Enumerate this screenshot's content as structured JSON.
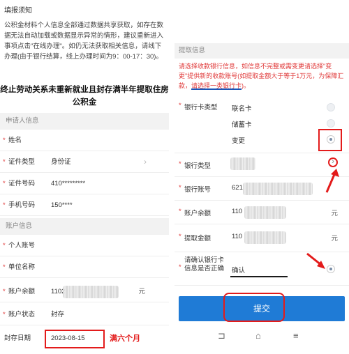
{
  "left": {
    "notice_title": "填报须知",
    "notice_body": "公积金材料个人信息全部通过数据共享获取，如存在数据无法自动加载或数据显示异常的情形，建议重新进入事项点击\"在线办理\"。如仍无法获取相关信息，请线下办理(由于银行结算，线上办理时间为9：00-17：30)。",
    "page_title": "终止劳动关系未重新就业且封存满半年提取住房公积金",
    "applicant_section": "申请人信息",
    "applicant_rows": [
      {
        "label": "姓名",
        "value": "",
        "required": true
      },
      {
        "label": "证件类型",
        "value": "身份证",
        "required": true,
        "chevron": "›"
      },
      {
        "label": "证件号码",
        "value": "410*********",
        "required": true
      },
      {
        "label": "手机号码",
        "value": "150****",
        "required": true
      }
    ],
    "account_section": "账户信息",
    "account_rows": [
      {
        "label": "个人账号",
        "value": "",
        "required": true
      },
      {
        "label": "单位名称",
        "value": "",
        "required": true
      },
      {
        "label": "账户余额",
        "value": "1102",
        "required": true,
        "unit": "元"
      },
      {
        "label": "账户状态",
        "value": "封存",
        "required": true
      },
      {
        "label": "封存日期",
        "value": "2023-08-15",
        "required": false
      }
    ],
    "annotation": "满六个月"
  },
  "right": {
    "section": "提取信息",
    "warning_a": "请选择收款银行信息，如信息不完整或需变更请选择\"变更\"提供新的收款账号(如提取金额大于等于1万元，为保障汇款，",
    "warning_b": "请选择一类银行卡",
    "warning_c": ")。",
    "card_type_label": "银行卡类型",
    "card_options": [
      {
        "label": "联名卡",
        "selected": false
      },
      {
        "label": "储蓄卡",
        "selected": false
      },
      {
        "label": "变更",
        "selected": true
      }
    ],
    "bank_type_label": "银行类型",
    "bank_type_chevron": "›",
    "bank_account_label": "银行账号",
    "bank_account_value": "621",
    "balance_label": "账户余额",
    "balance_value": "110",
    "balance_unit": "元",
    "amount_label": "提取金额",
    "amount_value": "110",
    "amount_unit": "元",
    "confirm_label": "请确认银行卡信息是否正确",
    "confirm_value": "确认",
    "submit_label": "提交",
    "nav": [
      "⊐",
      "⌂",
      "≡"
    ]
  },
  "colors": {
    "accent": "#1f7bd6",
    "annotation_red": "#e31b1b",
    "required_red": "#e03a3a"
  }
}
